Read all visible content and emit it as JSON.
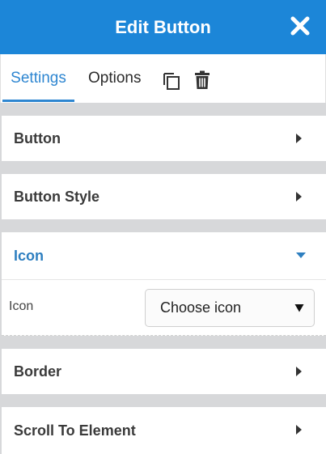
{
  "header": {
    "title": "Edit Button",
    "close_icon": "close-icon"
  },
  "tabs": [
    {
      "label": "Settings",
      "active": true
    },
    {
      "label": "Options",
      "active": false
    }
  ],
  "toolbar": {
    "copy_icon": "copy-icon",
    "delete_icon": "trash-icon"
  },
  "sections": [
    {
      "label": "Button",
      "expanded": false
    },
    {
      "label": "Button Style",
      "expanded": false
    },
    {
      "label": "Icon",
      "expanded": true
    },
    {
      "label": "Border",
      "expanded": false
    },
    {
      "label": "Scroll To Element",
      "expanded": false
    }
  ],
  "icon_field": {
    "label": "Icon",
    "select_value": "Choose icon"
  },
  "colors": {
    "header_bg": "#1c86d8",
    "accent": "#2e86d1",
    "panel_bg": "#d7d8da"
  }
}
